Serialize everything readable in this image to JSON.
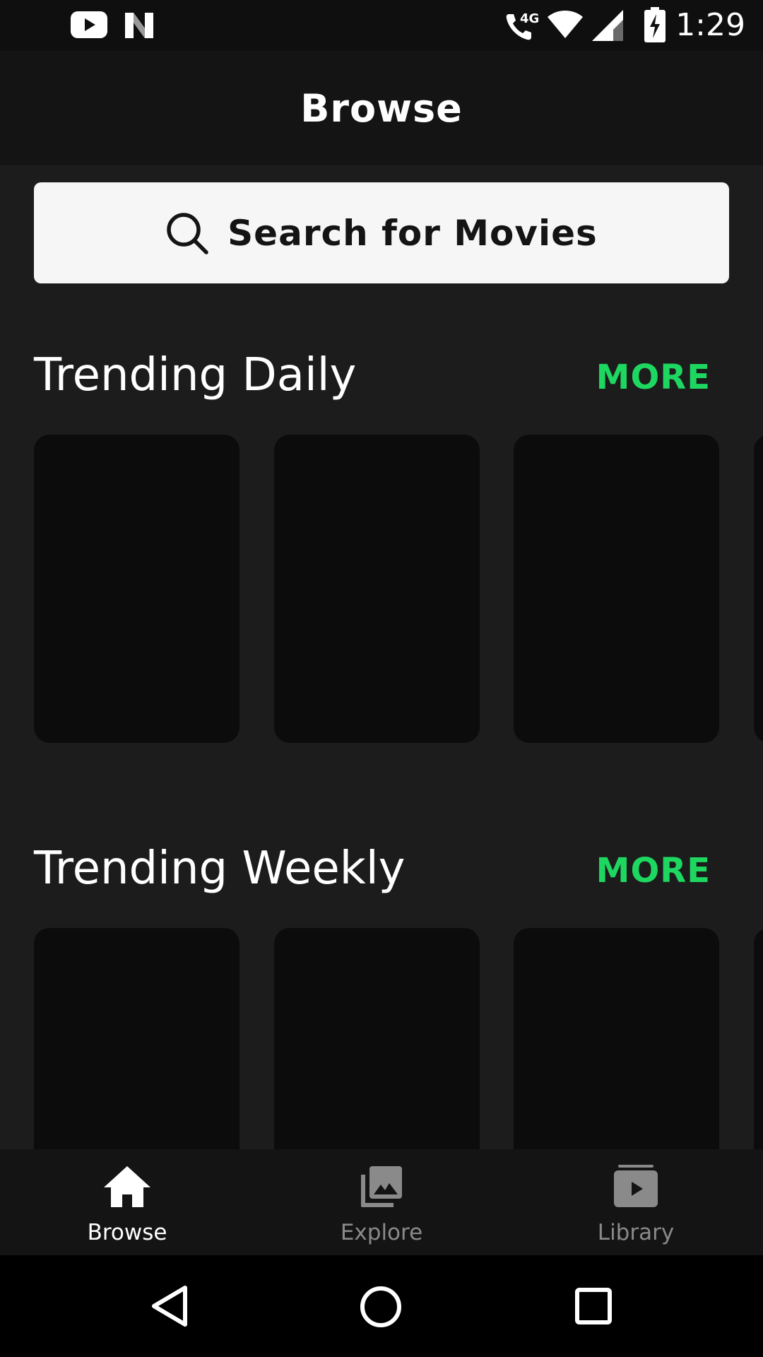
{
  "status_bar": {
    "time": "1:29",
    "icons": [
      "youtube-icon",
      "n-app-icon",
      "call-4g-icon",
      "wifi-icon",
      "signal-icon",
      "battery-charging-icon"
    ]
  },
  "header": {
    "title": "Browse"
  },
  "search": {
    "label": "Search for Movies",
    "icon": "search-icon"
  },
  "sections": [
    {
      "title": "Trending Daily",
      "more_label": "MORE"
    },
    {
      "title": "Trending Weekly",
      "more_label": "MORE"
    }
  ],
  "bottom_nav": {
    "items": [
      {
        "label": "Browse",
        "icon": "home-icon",
        "active": true
      },
      {
        "label": "Explore",
        "icon": "photo-library-icon",
        "active": false
      },
      {
        "label": "Library",
        "icon": "video-library-icon",
        "active": false
      }
    ],
    "active_color": "#ffffff",
    "inactive_color": "#8a8a8a"
  },
  "colors": {
    "accent": "#1ed760",
    "background": "#1c1c1c",
    "poster_placeholder": "#0c0c0c"
  }
}
